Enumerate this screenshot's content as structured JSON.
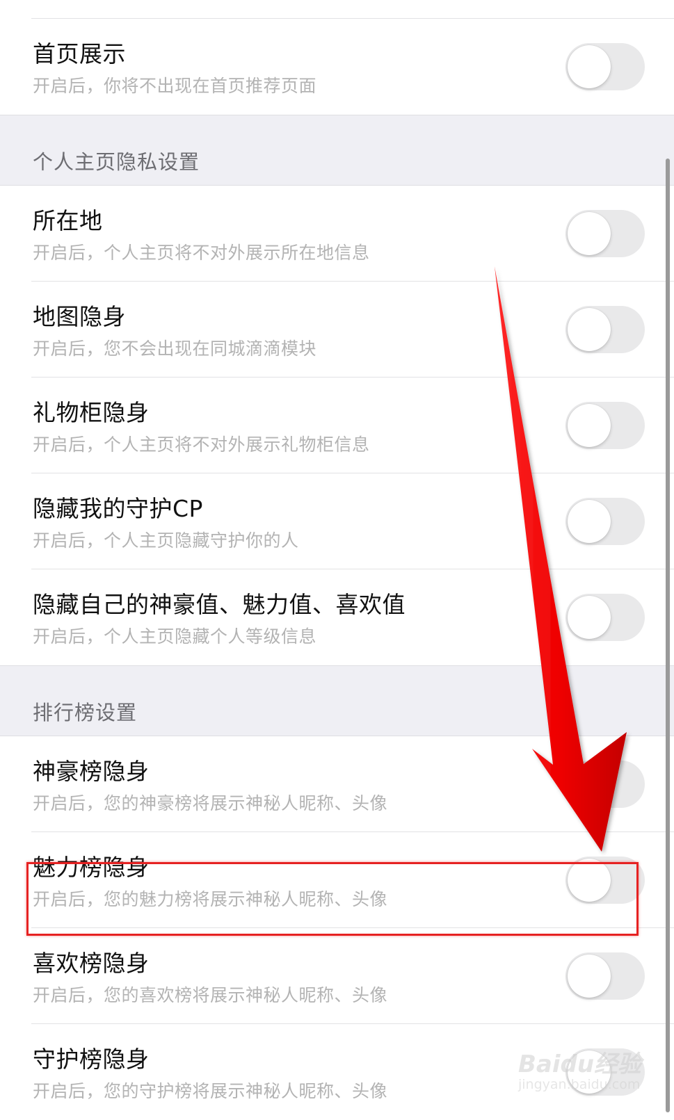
{
  "rows": [
    {
      "title": "首页展示",
      "desc": "开启后，你将不出现在首页推荐页面",
      "on": false
    },
    {
      "title": "所在地",
      "desc": "开启后，个人主页将不对外展示所在地信息",
      "on": false
    },
    {
      "title": "地图隐身",
      "desc": "开启后，您不会出现在同城滴滴模块",
      "on": false
    },
    {
      "title": "礼物柜隐身",
      "desc": "开启后，个人主页将不对外展示礼物柜信息",
      "on": false
    },
    {
      "title": "隐藏我的守护CP",
      "desc": "开启后，个人主页隐藏守护你的人",
      "on": false
    },
    {
      "title": "隐藏自己的神豪值、魅力值、喜欢值",
      "desc": "开启后，个人主页隐藏个人等级信息",
      "on": false
    },
    {
      "title": "神豪榜隐身",
      "desc": "开启后，您的神豪榜将展示神秘人昵称、头像",
      "on": false
    },
    {
      "title": "魅力榜隐身",
      "desc": "开启后，您的魅力榜将展示神秘人昵称、头像",
      "on": false
    },
    {
      "title": "喜欢榜隐身",
      "desc": "开启后，您的喜欢榜将展示神秘人昵称、头像",
      "on": false
    },
    {
      "title": "守护榜隐身",
      "desc": "开启后，您的守护榜将展示神秘人昵称、头像",
      "on": false
    }
  ],
  "sections": {
    "profile_privacy": "个人主页隐私设置",
    "leaderboard": "排行榜设置"
  },
  "watermark": {
    "main": "Baidu经验",
    "sub": "jingyan.baidu.com"
  },
  "colors": {
    "annotation_red": "#e60000",
    "toggle_off": "#e9e9ea",
    "section_bg": "#efeff4"
  }
}
